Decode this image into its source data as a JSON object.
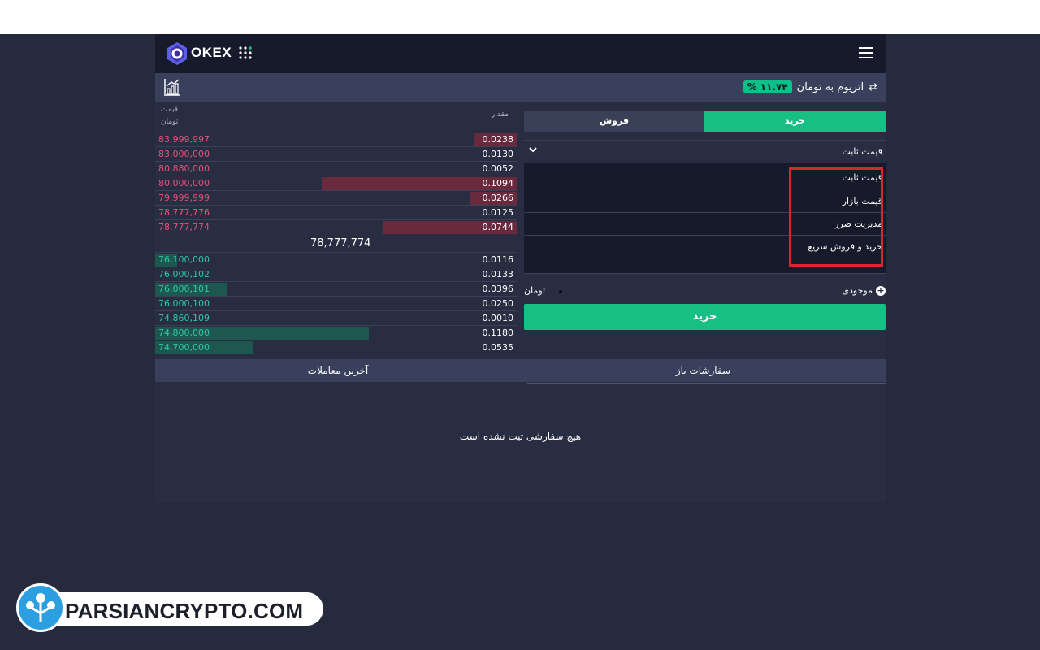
{
  "navbar": {
    "logo_text": "OKEX",
    "menu_icon": "hamburger-icon",
    "apps_icon": "grid-apps-icon"
  },
  "pair": {
    "title": "اتریوم به تومان",
    "change": "% ۱۱.۷۴",
    "swap_icon": "swap-arrows-icon",
    "chart_icon": "chart-icon"
  },
  "orderbook": {
    "price_header": "قیمت",
    "price_unit": "تومان",
    "qty_header": "مقدار",
    "asks": [
      {
        "price": "83,999,997",
        "qty": "0.0238",
        "depth": 0.12
      },
      {
        "price": "83,000,000",
        "qty": "0.0130",
        "depth": 0.0
      },
      {
        "price": "80,880,000",
        "qty": "0.0052",
        "depth": 0.0
      },
      {
        "price": "80,000,000",
        "qty": "0.1094",
        "depth": 0.54
      },
      {
        "price": "79,999,999",
        "qty": "0.0266",
        "depth": 0.13
      },
      {
        "price": "78,777,776",
        "qty": "0.0125",
        "depth": 0.0
      },
      {
        "price": "78,777,774",
        "qty": "0.0744",
        "depth": 0.37
      }
    ],
    "mid_price": "78,777,774",
    "bids": [
      {
        "price": "76,100,000",
        "qty": "0.0116",
        "depth": 0.06
      },
      {
        "price": "76,000,102",
        "qty": "0.0133",
        "depth": 0.0
      },
      {
        "price": "76,000,101",
        "qty": "0.0396",
        "depth": 0.2
      },
      {
        "price": "76,000,100",
        "qty": "0.0250",
        "depth": 0.0
      },
      {
        "price": "74,860,109",
        "qty": "0.0010",
        "depth": 0.0
      },
      {
        "price": "74,800,000",
        "qty": "0.1180",
        "depth": 0.59
      },
      {
        "price": "74,700,000",
        "qty": "0.0535",
        "depth": 0.27
      }
    ]
  },
  "trade_form": {
    "tab_sell": "فروش",
    "tab_buy": "خرید",
    "order_type_selected": "قیمت ثابت",
    "order_type_options": [
      "قیمت ثابت",
      "قیمت بازار",
      "مدیریت ضرر",
      "خرید و فروش سریع"
    ],
    "balance_label": "موجودی",
    "balance_unit": "تومان",
    "submit_label": "خرید"
  },
  "bottom_tabs": {
    "trades": "آخرین معاملات",
    "open_orders": "سفارشات باز"
  },
  "empty_state": "هیچ سفارشی ثبت نشده است",
  "watermark": {
    "text": "PARSIANCRYPTO.COM"
  },
  "colors": {
    "buy": "#17bf85",
    "ask": "#e8507a",
    "bid": "#2ec7a6",
    "highlight": "#d7262f"
  }
}
